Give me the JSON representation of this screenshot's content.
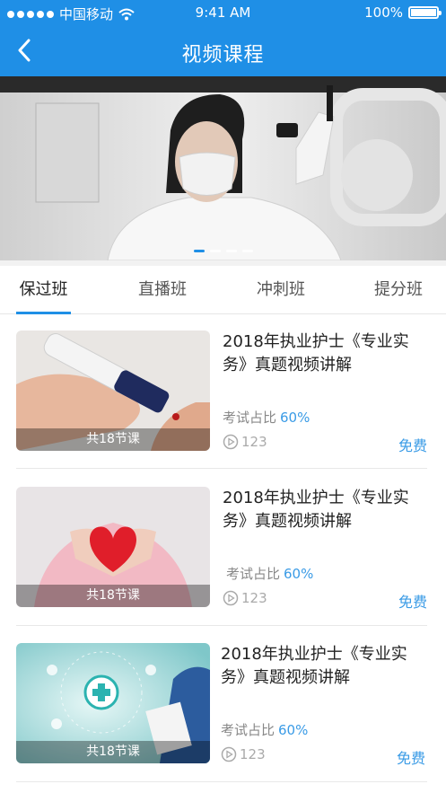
{
  "status_bar": {
    "carrier": "中国移动",
    "time": "9:41 AM",
    "battery": "100%"
  },
  "nav": {
    "title": "视频课程",
    "back_icon": "chevron-left-icon"
  },
  "banner": {
    "slides": 4,
    "active_index": 0,
    "accent": "#1f8fe6"
  },
  "tabs": [
    {
      "label": "保过班",
      "active": true
    },
    {
      "label": "直播班",
      "active": false
    },
    {
      "label": "冲刺班",
      "active": false
    },
    {
      "label": "提分班",
      "active": false
    }
  ],
  "courses": [
    {
      "title": "2018年执业护士《专业实务》真题视频讲解",
      "lessons": "共18节课",
      "ratio_label": "考试占比",
      "ratio_value": "60%",
      "views": "123",
      "price": "免费"
    },
    {
      "title": "2018年执业护士《专业实务》真题视频讲解",
      "lessons": "共18节课",
      "ratio_label": "考试占比",
      "ratio_value": "60%",
      "views": "123",
      "price": "免费"
    },
    {
      "title": "2018年执业护士《专业实务》真题视频讲解",
      "lessons": "共18节课",
      "ratio_label": "考试占比",
      "ratio_value": "60%",
      "views": "123",
      "price": "免费"
    }
  ],
  "colors": {
    "primary": "#1f8fe6",
    "link": "#3a9be6"
  }
}
